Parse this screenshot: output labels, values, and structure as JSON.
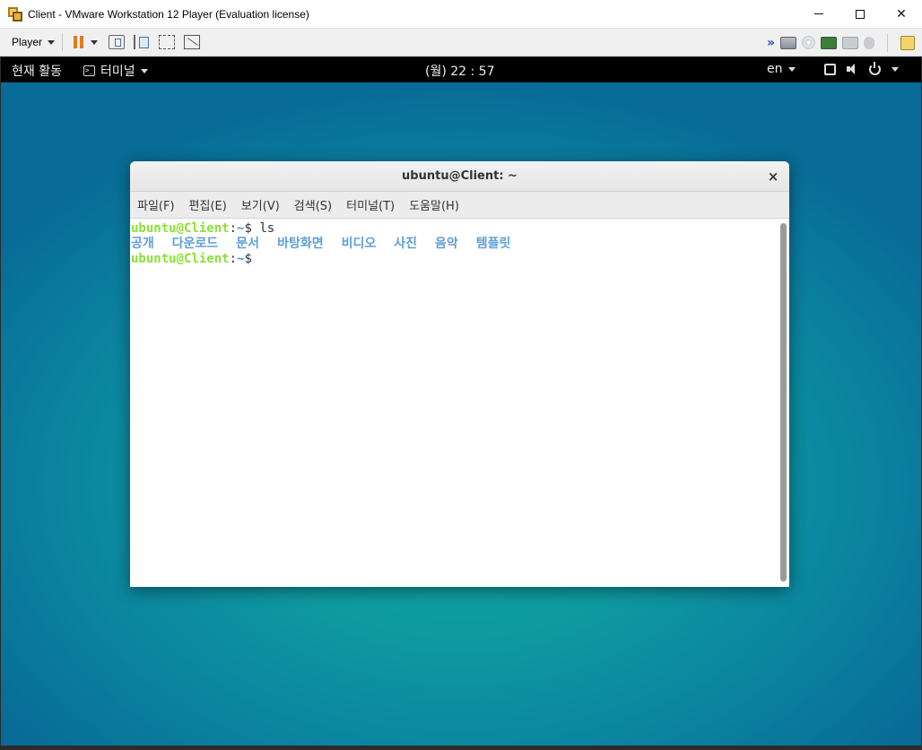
{
  "window": {
    "title": "Client - VMware Workstation 12 Player (Evaluation license)",
    "min_glyph": "",
    "close_glyph": "✕"
  },
  "toolbar": {
    "player_label": "Player",
    "more_glyph": "»"
  },
  "gnome": {
    "activities": "현재 활동",
    "app_menu": "터미널",
    "clock": "(월) 22 : 57",
    "input_lang": "en"
  },
  "terminal": {
    "title": "ubuntu@Client: ~",
    "close_glyph": "×",
    "menu": [
      {
        "label": "파일(F)"
      },
      {
        "label": "편집(E)"
      },
      {
        "label": "보기(V)"
      },
      {
        "label": "검색(S)"
      },
      {
        "label": "터미널(T)"
      },
      {
        "label": "도움말(H)"
      }
    ],
    "prompt_user": "ubuntu@Client",
    "prompt_sep": ":",
    "prompt_path": "~",
    "prompt_symbol": "$ ",
    "command": "ls",
    "dirs": [
      "공개",
      "다운로드",
      "문서",
      "바탕화면",
      "비디오",
      "사진",
      "음악",
      "템플릿"
    ]
  },
  "colors": {
    "prompt_user": "#8ae234",
    "directory": "#5f9fd8",
    "desktop": "#0e9aa0"
  }
}
